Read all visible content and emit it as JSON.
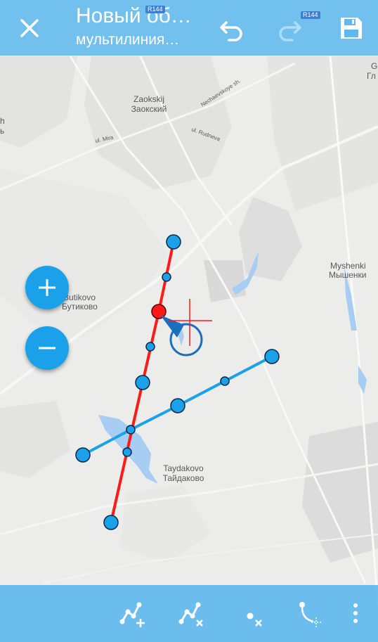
{
  "toolbar": {
    "title": "Новый об…",
    "subtitle": "мультилиния…",
    "close_icon": "close-icon",
    "undo_icon": "undo-icon",
    "redo_icon": "redo-icon",
    "save_icon": "save-icon",
    "badge": "R144"
  },
  "map": {
    "labels": {
      "zaokskij_lat": "Zaokskij",
      "zaokskij_cyr": "Заокский",
      "nechaevskoye": "Nechaevskoye sh.",
      "rudneva": "ul. Rudneva",
      "mira": "ul. Mira",
      "butikovo_lat": "Butikovo",
      "butikovo_cyr": "Бутиково",
      "myshenki_lat": "Myshenki",
      "myshenki_cyr": "Мышенки",
      "taydakovo_lat": "Taydakovo",
      "taydakovo_cyr": "Тайдаково",
      "edge_right_top": "G",
      "edge_right_top2": "Гл",
      "edge_left_1": "h",
      "edge_left_2": "ь"
    },
    "accent_color": "#1aa1ea",
    "active_line_color": "#ff1a1a",
    "inactive_line_color": "#1aa1ea"
  },
  "zoom": {
    "in_icon": "plus-icon",
    "out_icon": "minus-icon"
  },
  "bottom_toolbar": {
    "add_point_icon": "add-vertex-icon",
    "delete_line_icon": "delete-line-icon",
    "delete_point_icon": "delete-point-icon",
    "split_icon": "split-line-icon",
    "menu_icon": "more-vert-icon"
  }
}
